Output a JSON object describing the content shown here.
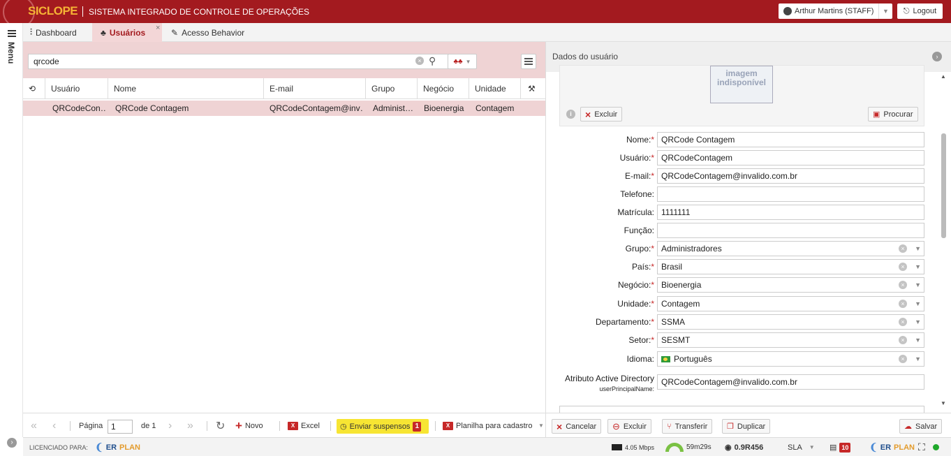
{
  "header": {
    "brand": "SICLOPE",
    "title": "SISTEMA INTEGRADO DE CONTROLE DE OPERAÇÕES",
    "user": "Arthur Martins (STAFF)",
    "logout": "Logout"
  },
  "sidebar": {
    "menu_label": "Menu"
  },
  "tabs": [
    {
      "label": "Dashboard"
    },
    {
      "label": "Usuários",
      "active": true
    },
    {
      "label": "Acesso Behavior"
    }
  ],
  "search": {
    "value": "qrcode"
  },
  "grid": {
    "columns": [
      "Usuário",
      "Nome",
      "E-mail",
      "Grupo",
      "Negócio",
      "Unidade"
    ],
    "rows": [
      {
        "usuario": "QRCodeCon…",
        "nome": "QRCode Contagem",
        "email": "QRCodeContagem@inv…",
        "grupo": "Administ…",
        "negocio": "Bioenergia",
        "unidade": "Contagem"
      }
    ]
  },
  "pager": {
    "page_label": "Página",
    "page_value": "1",
    "of_label": "de 1",
    "novo": "Novo",
    "excel": "Excel",
    "enviar": "Enviar suspensos",
    "enviar_count": "1",
    "planilha": "Planilha para cadastro"
  },
  "detail": {
    "title": "Dados do usuário",
    "photo_text": "imagem indisponível",
    "excluir_foto": "Excluir",
    "procurar": "Procurar",
    "fields": [
      {
        "label": "Nome:",
        "value": "QRCode Contagem",
        "required": true
      },
      {
        "label": "Usuário:",
        "value": "QRCodeContagem",
        "required": true
      },
      {
        "label": "E-mail:",
        "value": "QRCodeContagem@invalido.com.br",
        "required": true
      },
      {
        "label": "Telefone:",
        "value": "",
        "required": false
      },
      {
        "label": "Matrícula:",
        "value": "1111111",
        "required": false
      },
      {
        "label": "Função:",
        "value": "",
        "required": false
      },
      {
        "label": "Grupo:",
        "value": "Administradores",
        "required": true,
        "select": true
      },
      {
        "label": "País:",
        "value": "Brasil",
        "required": true,
        "select": true
      },
      {
        "label": "Negócio:",
        "value": "Bioenergia",
        "required": true,
        "select": true
      },
      {
        "label": "Unidade:",
        "value": "Contagem",
        "required": true,
        "select": true
      },
      {
        "label": "Departamento:",
        "value": "SSMA",
        "required": true,
        "select": true
      },
      {
        "label": "Setor:",
        "value": "SESMT",
        "required": true,
        "select": true
      },
      {
        "label": "Idioma:",
        "value": "Português",
        "required": false,
        "select": true,
        "flag": true
      }
    ],
    "ad_label": "Atributo Active Directory",
    "ad_sub": "userPrincipalName:",
    "ad_value": "QRCodeContagem@invalido.com.br",
    "buttons": {
      "cancelar": "Cancelar",
      "excluir": "Excluir",
      "transferir": "Transferir",
      "duplicar": "Duplicar",
      "salvar": "Salvar"
    }
  },
  "status": {
    "licensed": "LICENCIADO PARA:",
    "erplan_er": "ER",
    "erplan_plan": "PLAN",
    "speed": "4.05 Mbps",
    "time": "59m29s",
    "version": "0.9R456",
    "sla": "SLA",
    "badge": "10"
  },
  "colors": {
    "brand_red": "#a31a1f",
    "brand_orange": "#f5b335",
    "selection": "#efd3d4",
    "highlight_yellow": "#f7e533"
  }
}
